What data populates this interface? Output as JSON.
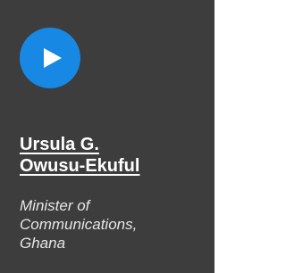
{
  "card": {
    "background_color": "#3d3d3d",
    "play_button": {
      "icon": "play-icon",
      "color": "#1788e3"
    },
    "name_lines": [
      "Ursula G.",
      "Owusu-Ekuful"
    ],
    "title_lines": [
      "Minister of",
      "Communications,",
      "Ghana"
    ]
  }
}
